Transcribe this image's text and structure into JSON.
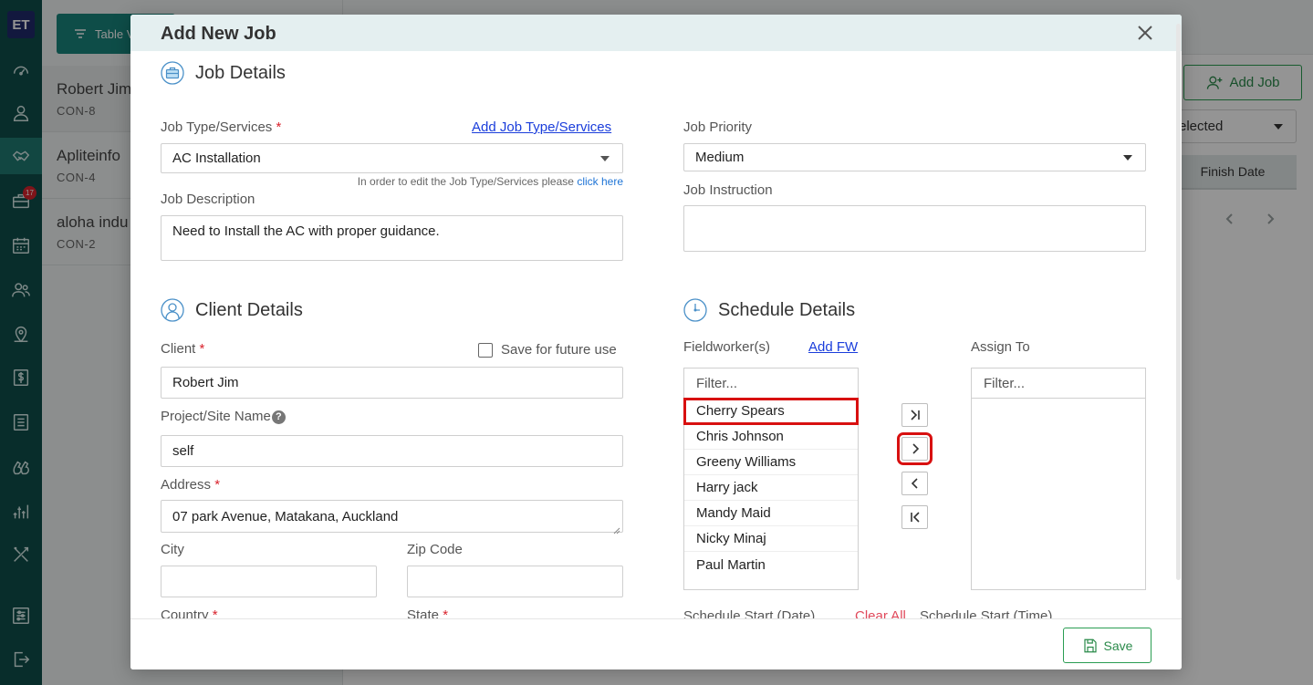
{
  "app": {
    "logo": "ET",
    "notification_badge": "17",
    "sidebar_icons": [
      "dashboard-icon",
      "user-icon",
      "handshake-icon",
      "briefcase-icon",
      "calendar-icon",
      "team-icon",
      "map-pin-icon",
      "dollar-icon",
      "list-icon",
      "chat-icon",
      "analytics-icon",
      "tools-icon",
      "settings-sliders-icon",
      "logout-icon"
    ]
  },
  "background": {
    "toolbar_button": "Table V",
    "list": [
      {
        "name": "Robert Jim",
        "code": "CON-8"
      },
      {
        "name": "Apliteinfo",
        "code": "CON-4"
      },
      {
        "name": "aloha indu",
        "code": "CON-2"
      }
    ],
    "add_job": "Add Job",
    "status_select": "elected",
    "column_header": "Finish Date"
  },
  "modal": {
    "title": "Add New Job",
    "job_details": {
      "title": "Job Details",
      "job_type_label": "Job Type/Services",
      "add_job_type_link": "Add Job Type/Services",
      "job_type_value": "AC Installation",
      "hint_text": "In order to edit the Job Type/Services please",
      "hint_link": "click here",
      "description_label": "Job Description",
      "description_value": "Need to Install the AC with proper guidance.",
      "priority_label": "Job Priority",
      "priority_value": "Medium",
      "instruction_label": "Job Instruction",
      "instruction_value": ""
    },
    "client_details": {
      "title": "Client Details",
      "client_label": "Client",
      "save_future_label": "Save for future use",
      "client_value": "Robert Jim",
      "project_label": "Project/Site Name",
      "project_help": "?",
      "project_value": "self",
      "address_label": "Address",
      "address_value": "07 park Avenue, Matakana, Auckland",
      "city_label": "City",
      "city_value": "",
      "zip_label": "Zip Code",
      "zip_value": "",
      "country_label": "Country",
      "state_label": "State"
    },
    "schedule_details": {
      "title": "Schedule Details",
      "fieldworkers_label": "Fieldworker(s)",
      "add_fw_link": "Add FW",
      "assign_to_label": "Assign To",
      "filter_placeholder": "Filter...",
      "fieldworkers": [
        "Cherry Spears",
        "Chris Johnson",
        "Greeny Williams",
        "Harry jack",
        "Mandy Maid",
        "Nicky Minaj",
        "Paul Martin"
      ],
      "assigned": [],
      "start_date_label": "Schedule Start (Date)",
      "clear_all": "Clear All",
      "start_time_label": "Schedule Start (Time)"
    },
    "save_label": "Save"
  }
}
